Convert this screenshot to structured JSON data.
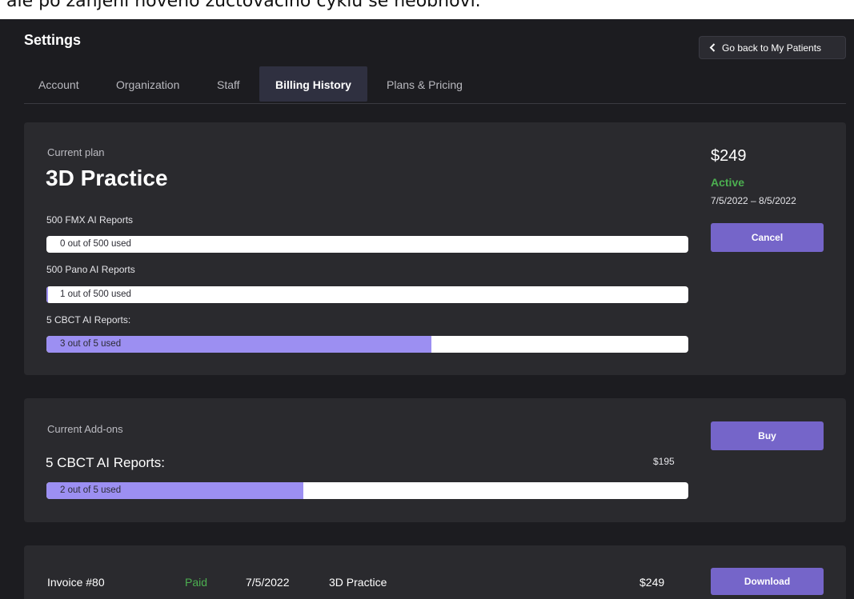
{
  "top_strip_text": "ale po zánjení nového zúčtovacího cyklu se neobnoví.",
  "header": {
    "title": "Settings",
    "back_button": "Go back to My Patients"
  },
  "tabs": [
    {
      "label": "Account",
      "active": false
    },
    {
      "label": "Organization",
      "active": false
    },
    {
      "label": "Staff",
      "active": false
    },
    {
      "label": "Billing History",
      "active": true
    },
    {
      "label": "Plans & Pricing",
      "active": false
    }
  ],
  "plan": {
    "label": "Current plan",
    "name": "3D Practice",
    "price": "$249",
    "status": "Active",
    "period": "7/5/2022 – 8/5/2022",
    "cancel_label": "Cancel",
    "quotas": [
      {
        "label": "500 FMX AI Reports",
        "used_text": "0 out of 500 used",
        "fraction": 0
      },
      {
        "label": "500 Pano AI Reports",
        "used_text": "1 out of 500 used",
        "fraction": 0.002
      },
      {
        "label": "5 CBCT AI Reports:",
        "used_text": "3 out of 5 used",
        "fraction": 0.6
      }
    ]
  },
  "addons": {
    "label": "Current Add-ons",
    "buy_label": "Buy",
    "item": {
      "name": "5 CBCT AI Reports:",
      "price": "$195",
      "used_text": "2 out of 5 used",
      "fraction": 0.4
    }
  },
  "invoice": {
    "number": "Invoice #80",
    "status": "Paid",
    "date": "7/5/2022",
    "plan": "3D Practice",
    "amount": "$249",
    "download_label": "Download"
  },
  "colors": {
    "background": "#1c1c20",
    "card": "#2a2a2e",
    "accent_button": "#7565c9",
    "progress_fill": "#9c8ff2",
    "status_active": "#4caf50",
    "status_paid": "#4caf50"
  }
}
